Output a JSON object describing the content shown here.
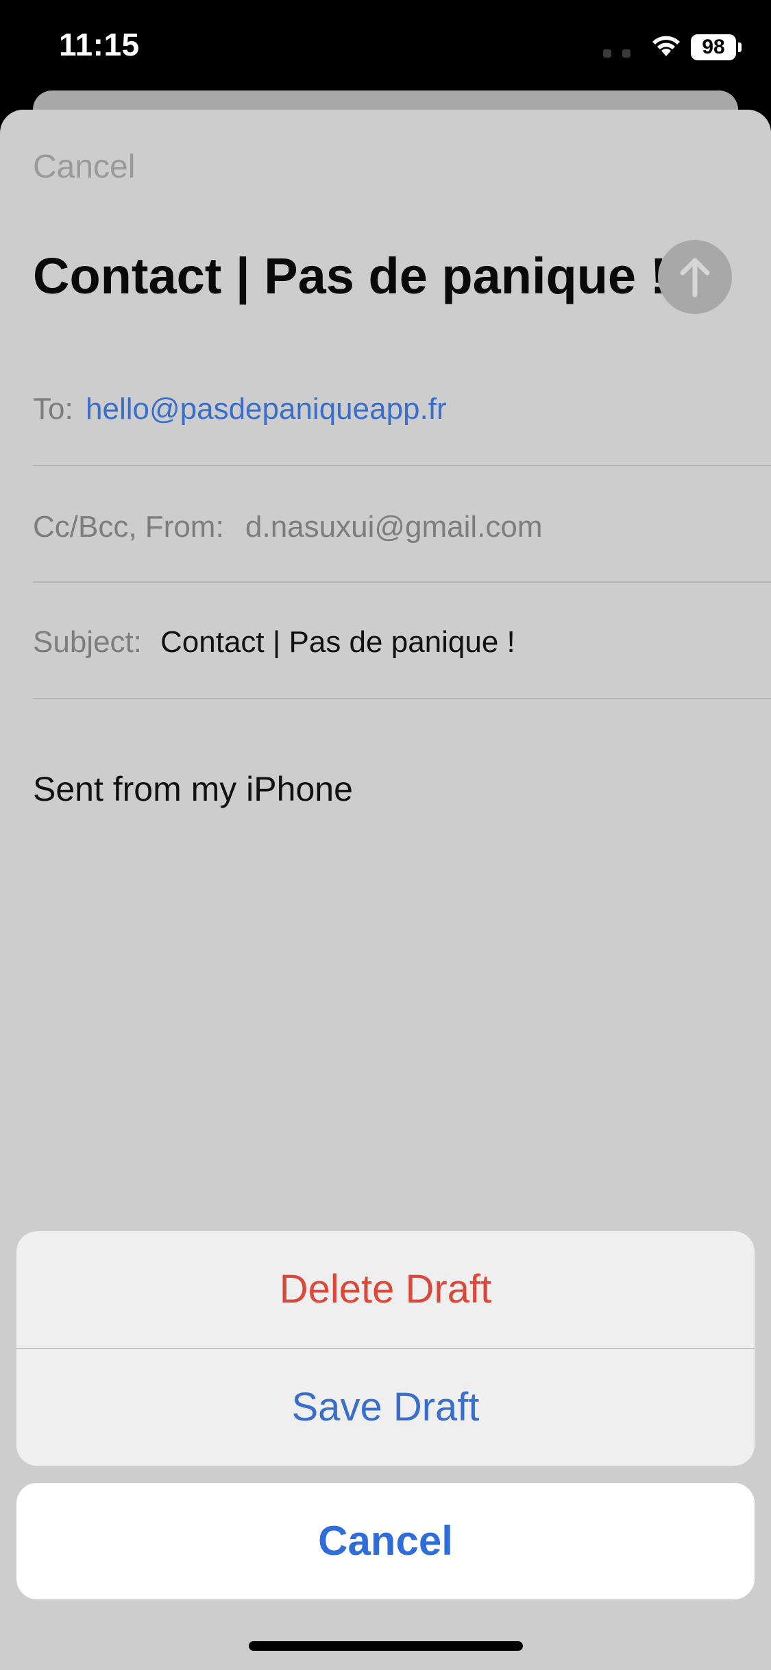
{
  "status_bar": {
    "time": "11:15",
    "battery_level": "98",
    "icons": [
      "signal-dots-icon",
      "wifi-icon",
      "battery-icon"
    ]
  },
  "compose": {
    "cancel_label": "Cancel",
    "title": "Contact | Pas de panique !",
    "send_icon": "arrow-up-icon",
    "to_label": "To:",
    "to_value": "hello@pasdepaniqueapp.fr",
    "ccbcc_label": "Cc/Bcc, From:",
    "from_value": "d.nasuxui@gmail.com",
    "subject_label": "Subject:",
    "subject_value": "Contact | Pas de panique !",
    "body": "Sent from my iPhone"
  },
  "action_sheet": {
    "delete_label": "Delete Draft",
    "save_label": "Save Draft",
    "cancel_label": "Cancel"
  },
  "colors": {
    "destructive": "#d9483b",
    "accent": "#2f6ddb",
    "link": "#3a6ecb"
  }
}
